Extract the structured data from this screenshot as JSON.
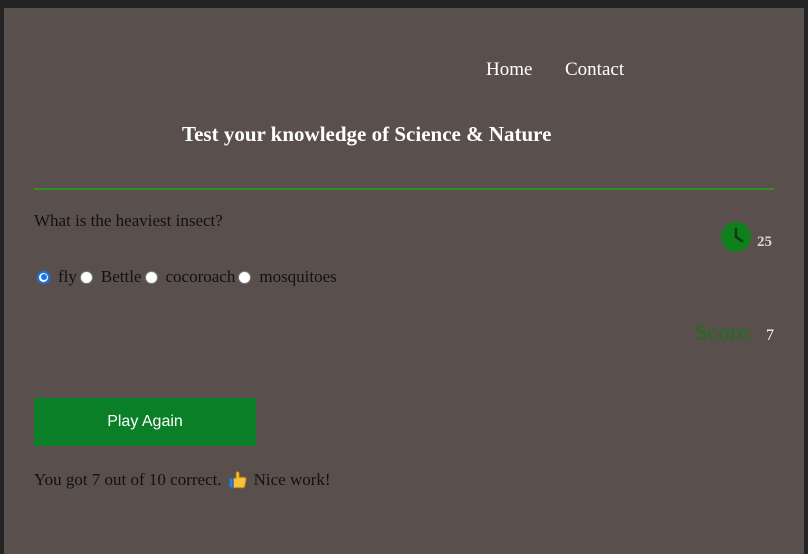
{
  "nav": {
    "home": "Home",
    "contact": "Contact"
  },
  "title": "Test your knowledge of Science & Nature",
  "question": "What is the heaviest insect?",
  "timer": {
    "icon": "clock-icon",
    "value": "25"
  },
  "answers": [
    {
      "label": "fly",
      "checked": true
    },
    {
      "label": "Bettle",
      "checked": false
    },
    {
      "label": "cocoroach",
      "checked": false
    },
    {
      "label": "mosquitoes",
      "checked": false
    }
  ],
  "score": {
    "label": "Score:",
    "value": "7"
  },
  "play_again": "Play Again",
  "result": {
    "prefix": "You got 7 out of 10 correct.",
    "icon": "thumbs-up-icon",
    "suffix": "Nice work!"
  },
  "colors": {
    "background": "#59504e",
    "accent_green": "#0b7f27",
    "divider": "#2f8f1f",
    "radio_selected": "#1a73e8"
  }
}
